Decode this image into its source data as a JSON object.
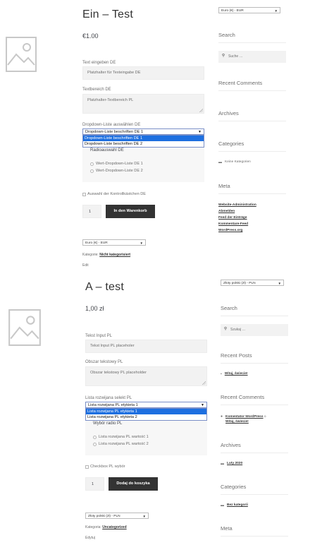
{
  "product1": {
    "title": "Ein – Test",
    "price": "€1.00",
    "text_label": "Text eingeben DE",
    "text_placeholder": "Platzhalter für Texteingabe DE",
    "textarea_label": "Textbereich DE",
    "textarea_placeholder": "Platzhalter-Textbereich PL",
    "dropdown_label": "Dropdown-Liste auswählen DE",
    "dropdown_value": "Dropdown-Liste beschriften DE 1",
    "dropdown_options": [
      "Dropdown-Liste beschriften DE 1",
      "Dropdown-Liste beschriften DE 2"
    ],
    "radio_title": "Radioauswahl DE",
    "radio_options": [
      "Wert-Dropdown-Liste DE 1",
      "Wert-Dropdown-Liste DE 2"
    ],
    "checkbox_label": "Auswahl der Kontrollkästchen DE",
    "qty": "1",
    "cart_button": "In den Warenkorb",
    "currency_select": "Euro (€) - EUR",
    "category_label": "Kategorie:",
    "category_link": "Nicht kategorisiert",
    "edit_link": "Edit"
  },
  "sidebar1": {
    "currency_select": "Euro (€) - EUR",
    "search_head": "Search",
    "search_placeholder": "Suche …",
    "recent_comments_head": "Recent Comments",
    "archives_head": "Archives",
    "categories_head": "Categories",
    "category_item": "Keine Kategorien",
    "meta_head": "Meta",
    "meta_links": [
      "Website-Administration",
      "Abmelden",
      "Feed der Einträge",
      "Kommentare-Feed",
      "WordPress.org"
    ]
  },
  "product2": {
    "title": "A – test",
    "price": "1,00 zł",
    "text_label": "Tekst Input PL",
    "text_placeholder": "Tekst Input PL placeholer",
    "textarea_label": "Obszar tekstowy PL",
    "textarea_placeholder": "Obszar tekstowy PL placeholder",
    "dropdown_label": "Lista rozwijana selekt PL",
    "dropdown_value": "Lista rozwijana PL etykieta 1",
    "dropdown_options": [
      "Lista rozwijana PL etykieta 1",
      "Lista rozwijana PL etykieta 2"
    ],
    "radio_title": "Wybór radio PL",
    "radio_options": [
      "Lista rozwijana PL wartość 1",
      "Lista rozwijana PL wartość 2"
    ],
    "checkbox_label": "Checkbox PL wybór",
    "qty": "1",
    "cart_button": "Dodaj do koszyka",
    "currency_select": "Złoty polski (zł) - PLN",
    "category_label": "Kategoria:",
    "category_link": "Uncategorized",
    "edit_link": "Edytuj"
  },
  "sidebar2": {
    "currency_select": "Złoty polski (zł) - PLN",
    "search_head": "Search",
    "search_placeholder": "Szukaj …",
    "recent_posts_head": "Recent Posts",
    "recent_post": "Witaj, świecie!",
    "recent_comments_head": "Recent Comments",
    "comment_author": "Komentator WordPress",
    "comment_on": " o ",
    "comment_post": "Witaj, świecie!",
    "archives_head": "Archives",
    "archive_item": "Luty 2020",
    "categories_head": "Categories",
    "category_item": "Bez kategorii",
    "meta_head": "Meta"
  },
  "icons": {
    "image_placeholder": "image-placeholder-icon",
    "search": "search-icon",
    "folder": "folder-icon",
    "comment": "comment-icon",
    "caret": "caret-down-icon"
  }
}
